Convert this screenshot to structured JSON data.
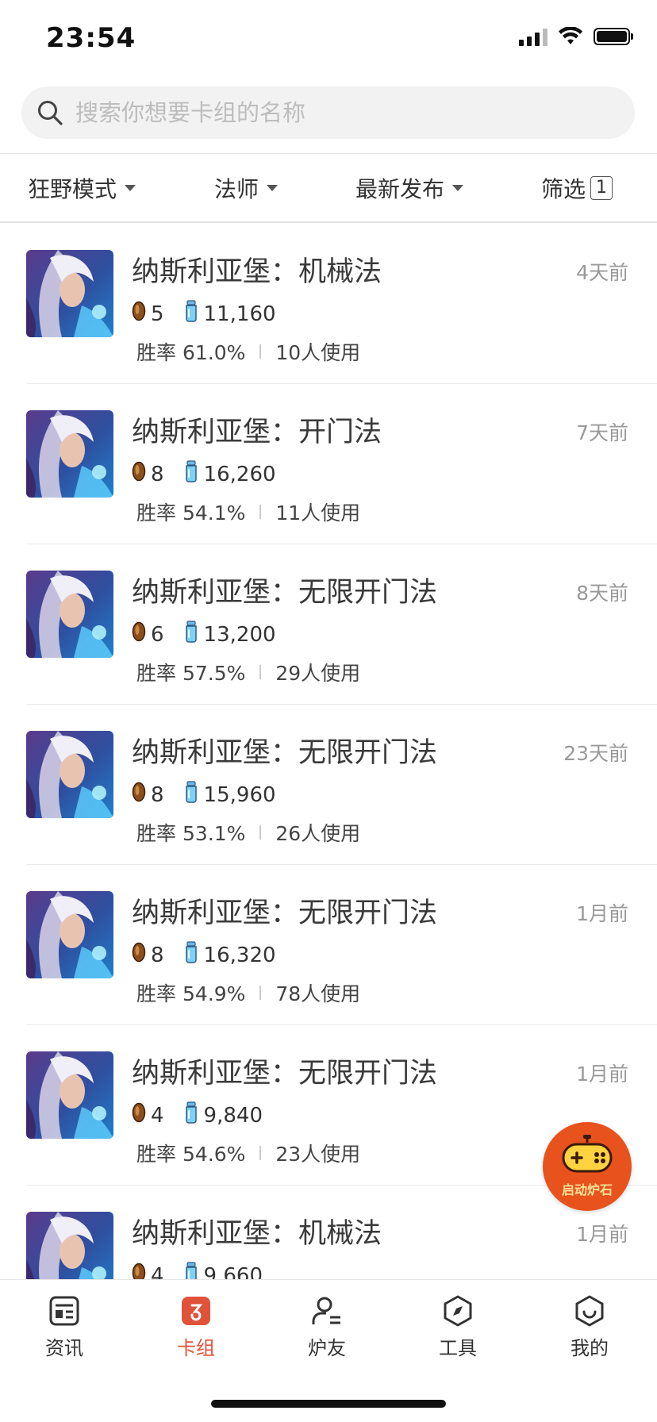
{
  "status_bar": {
    "time": "23:54"
  },
  "search": {
    "placeholder": "搜索你想要卡组的名称"
  },
  "filters": {
    "mode": "狂野模式",
    "class": "法师",
    "sort": "最新发布",
    "filter_label": "筛选",
    "filter_count": "1"
  },
  "decks": [
    {
      "title": "纳斯利亚堡：机械法",
      "time": "4天前",
      "legendary": "5",
      "dust": "11,160",
      "winrate": "胜率 61.0%",
      "users": "10人使用"
    },
    {
      "title": "纳斯利亚堡：开门法",
      "time": "7天前",
      "legendary": "8",
      "dust": "16,260",
      "winrate": "胜率 54.1%",
      "users": "11人使用"
    },
    {
      "title": "纳斯利亚堡：无限开门法",
      "time": "8天前",
      "legendary": "6",
      "dust": "13,200",
      "winrate": "胜率 57.5%",
      "users": "29人使用"
    },
    {
      "title": "纳斯利亚堡：无限开门法",
      "time": "23天前",
      "legendary": "8",
      "dust": "15,960",
      "winrate": "胜率 53.1%",
      "users": "26人使用"
    },
    {
      "title": "纳斯利亚堡：无限开门法",
      "time": "1月前",
      "legendary": "8",
      "dust": "16,320",
      "winrate": "胜率 54.9%",
      "users": "78人使用"
    },
    {
      "title": "纳斯利亚堡：无限开门法",
      "time": "1月前",
      "legendary": "4",
      "dust": "9,840",
      "winrate": "胜率 54.6%",
      "users": "23人使用"
    },
    {
      "title": "纳斯利亚堡：机械法",
      "time": "1月前",
      "legendary": "4",
      "dust": "9,660",
      "winrate": "",
      "users": ""
    }
  ],
  "launch_button": {
    "label": "启动炉石"
  },
  "tabs": [
    {
      "label": "资讯"
    },
    {
      "label": "卡组"
    },
    {
      "label": "炉友"
    },
    {
      "label": "工具"
    },
    {
      "label": "我的"
    }
  ],
  "colors": {
    "accent": "#e0533a",
    "launch_button": "#e8521c"
  }
}
